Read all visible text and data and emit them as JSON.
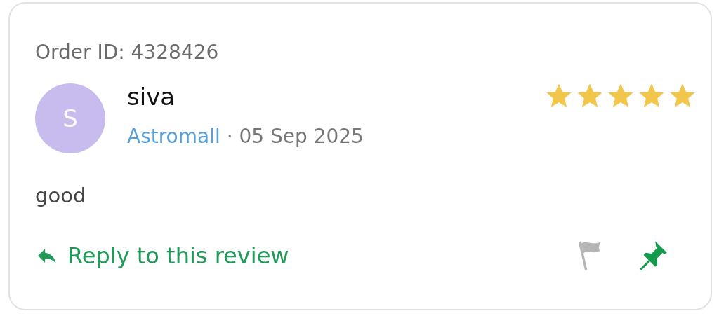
{
  "order_id": "Order ID: 4328426",
  "review": {
    "avatar_letter": "S",
    "name": "siva",
    "source": "Astromall",
    "separator": "·",
    "date": "05 Sep 2025",
    "stars": 5,
    "text": "good"
  },
  "actions": {
    "reply_label": "Reply to this review",
    "flagged": false,
    "pinned": true
  }
}
